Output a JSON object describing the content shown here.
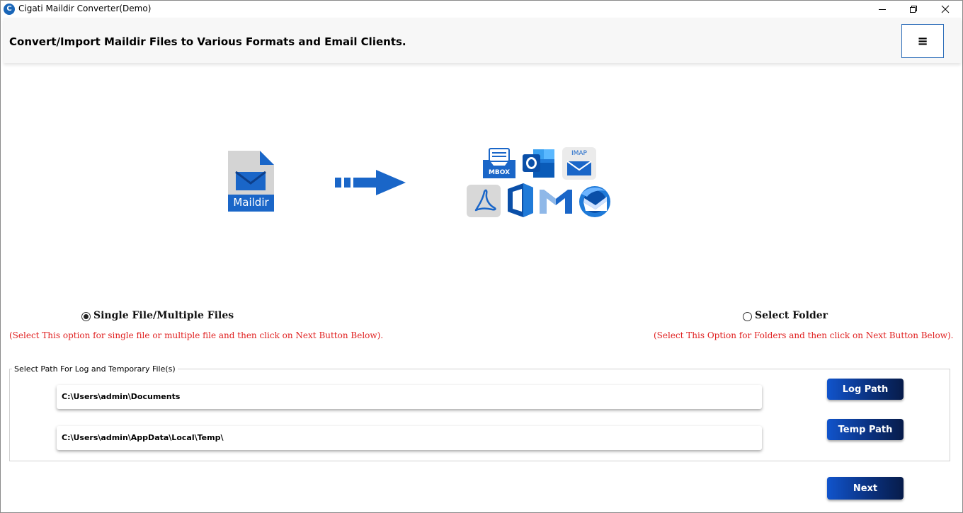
{
  "window": {
    "title": "Cigati Maildir Converter(Demo)",
    "app_icon_glyph": "C",
    "controls": [
      "minimize-icon",
      "restore-icon",
      "close-icon"
    ]
  },
  "header": {
    "title": "Convert/Import Maildir Files to Various Formats and Email Clients.",
    "menu_glyph": "≡"
  },
  "illustration": {
    "source_label": "Maildir",
    "target_badges": {
      "mbox": "MBOX",
      "imap": "IMAP"
    },
    "target_icons": [
      "mbox-icon",
      "outlook-icon",
      "imap-icon",
      "pdf-icon",
      "office365-icon",
      "gmail-icon",
      "thunderbird-icon"
    ],
    "arrow_icon": "arrow-right-icon"
  },
  "options": {
    "single": {
      "label": "Single File/Multiple Files",
      "selected": true,
      "hint": "(Select This option for single file or multiple file and then click on Next Button Below)."
    },
    "folder": {
      "label": "Select Folder",
      "selected": false,
      "hint": "(Select This Option for Folders and then click on Next Button Below)."
    }
  },
  "paths": {
    "legend": "Select Path For Log and Temporary File(s)",
    "log_path": "C:\\Users\\admin\\Documents",
    "temp_path": "C:\\Users\\admin\\AppData\\Local\\Temp\\",
    "log_button": "Log Path",
    "temp_button": "Temp Path"
  },
  "footer": {
    "next_button": "Next"
  },
  "colors": {
    "brand_blue": "#1a66c8",
    "button_dark": "#0a2f7a",
    "hint_red": "#e02020"
  }
}
